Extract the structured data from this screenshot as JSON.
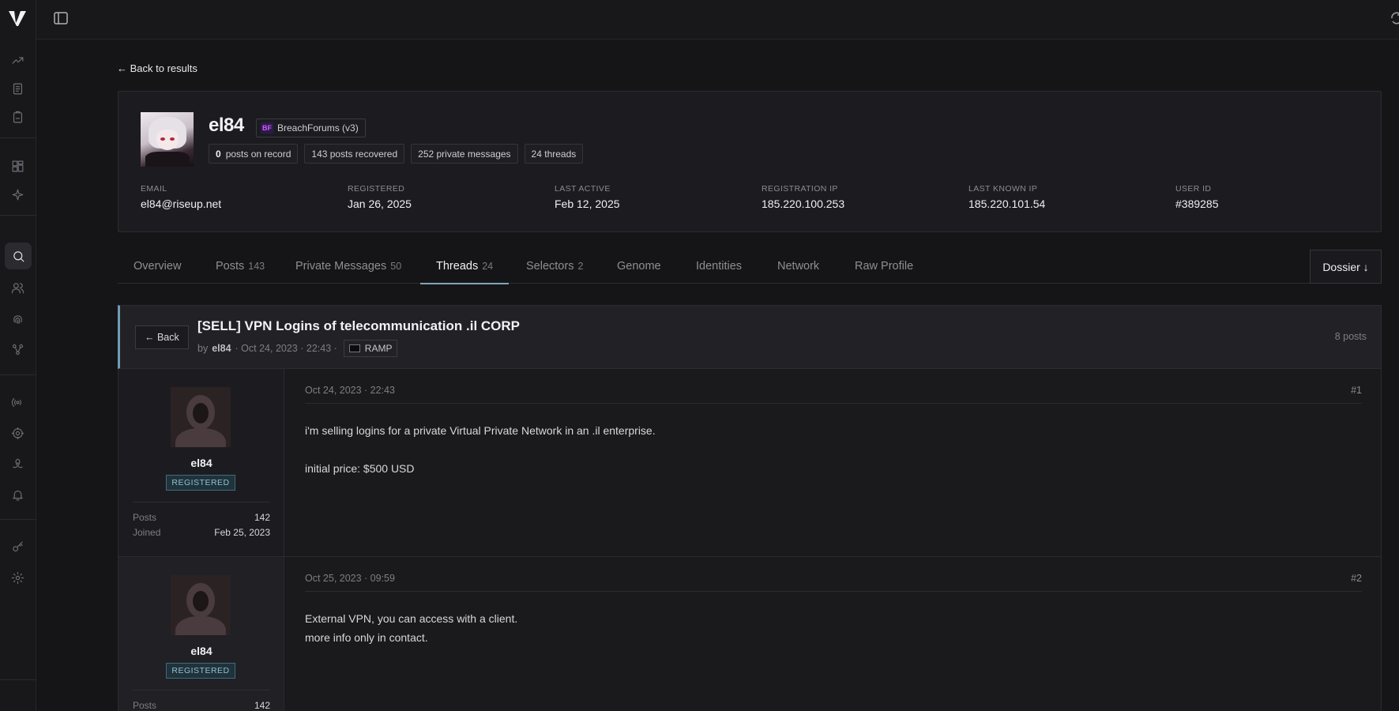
{
  "topbar": {
    "panel_toggle": "panel-toggle-icon",
    "sync": "sync-icon"
  },
  "sidebar": {
    "icons": [
      "trending-icon",
      "reports-icon",
      "clipboard-icon",
      "dashboard-icon",
      "sparkle-icon",
      "search-icon",
      "users-icon",
      "fingerprint-icon",
      "graph-icon",
      "radio-icon",
      "target-icon",
      "biohazard-icon",
      "bell-icon",
      "key-icon",
      "settings-icon"
    ],
    "active": "search-icon"
  },
  "nav": {
    "back_to_results": "← Back to results"
  },
  "profile": {
    "username": "el84",
    "forum": {
      "icon_text": "BF",
      "name": "BreachForums (v3)"
    },
    "stats": [
      {
        "value": "0",
        "label": "posts on record"
      },
      {
        "value": "",
        "label": "143 posts recovered"
      },
      {
        "value": "",
        "label": "252 private messages"
      },
      {
        "value": "",
        "label": "24 threads"
      }
    ],
    "meta": [
      {
        "label": "EMAIL",
        "value": "el84@riseup.net"
      },
      {
        "label": "REGISTERED",
        "value": "Jan 26, 2025"
      },
      {
        "label": "LAST ACTIVE",
        "value": "Feb 12, 2025"
      },
      {
        "label": "REGISTRATION IP",
        "value": "185.220.100.253"
      },
      {
        "label": "LAST KNOWN IP",
        "value": "185.220.101.54"
      },
      {
        "label": "USER ID",
        "value": "#389285"
      }
    ]
  },
  "tabs": [
    {
      "label": "Overview",
      "count": ""
    },
    {
      "label": "Posts",
      "count": "143"
    },
    {
      "label": "Private Messages",
      "count": "50"
    },
    {
      "label": "Threads",
      "count": "24"
    },
    {
      "label": "Selectors",
      "count": "2"
    },
    {
      "label": "Genome",
      "count": ""
    },
    {
      "label": "Identities",
      "count": ""
    },
    {
      "label": "Network",
      "count": ""
    },
    {
      "label": "Raw Profile",
      "count": ""
    }
  ],
  "active_tab": "Threads",
  "dossier_button": "Dossier ↓",
  "thread": {
    "back_label": "← Back",
    "title": "[SELL] VPN Logins of telecommunication .il CORP",
    "by": "by",
    "author": "el84",
    "date": "· Oct 24, 2023 · 22:43 ·",
    "source": "RAMP",
    "post_count": "8 posts"
  },
  "posts": [
    {
      "author": "el84",
      "badge": "REGISTERED",
      "posts_label": "Posts",
      "posts_value": "142",
      "joined_label": "Joined",
      "joined_value": "Feb 25, 2023",
      "date": "Oct 24, 2023 · 22:43",
      "num": "#1",
      "lines": [
        "i'm selling logins for a private Virtual Private Network in an .il enterprise.",
        "",
        "initial price: $500 USD"
      ]
    },
    {
      "author": "el84",
      "badge": "REGISTERED",
      "posts_label": "Posts",
      "posts_value": "142",
      "joined_label": "Joined",
      "joined_value": "",
      "date": "Oct 25, 2023 · 09:59",
      "num": "#2",
      "lines": [
        "External VPN, you can access with a client.",
        "more info only in contact."
      ]
    }
  ]
}
